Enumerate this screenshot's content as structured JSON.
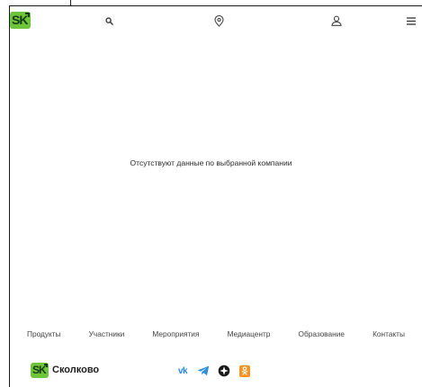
{
  "header": {
    "logo_text": "SK",
    "icons": {
      "search": "search-icon",
      "location": "location-pin-icon",
      "user": "user-icon",
      "menu": "hamburger-menu-icon"
    }
  },
  "main": {
    "empty_message": "Отсутствуют данные по выбранной компании"
  },
  "footer": {
    "nav": [
      {
        "label": "Продукты"
      },
      {
        "label": "Участники"
      },
      {
        "label": "Мероприятия"
      },
      {
        "label": "Медиацентр"
      },
      {
        "label": "Образование"
      },
      {
        "label": "Контакты"
      }
    ],
    "brand_logo_text": "SK",
    "brand_name": "Сколково",
    "social": {
      "vk_text": "vk",
      "telegram": "telegram-icon",
      "livejournal": "livejournal-icon",
      "odnoklassniki": "odnoklassniki-icon"
    }
  },
  "colors": {
    "brand_green": "#6ec43a",
    "brand_dark": "#163b12",
    "vk_blue": "#2787f5",
    "telegram_blue": "#2f8fd9",
    "ok_orange": "#f7931e"
  }
}
